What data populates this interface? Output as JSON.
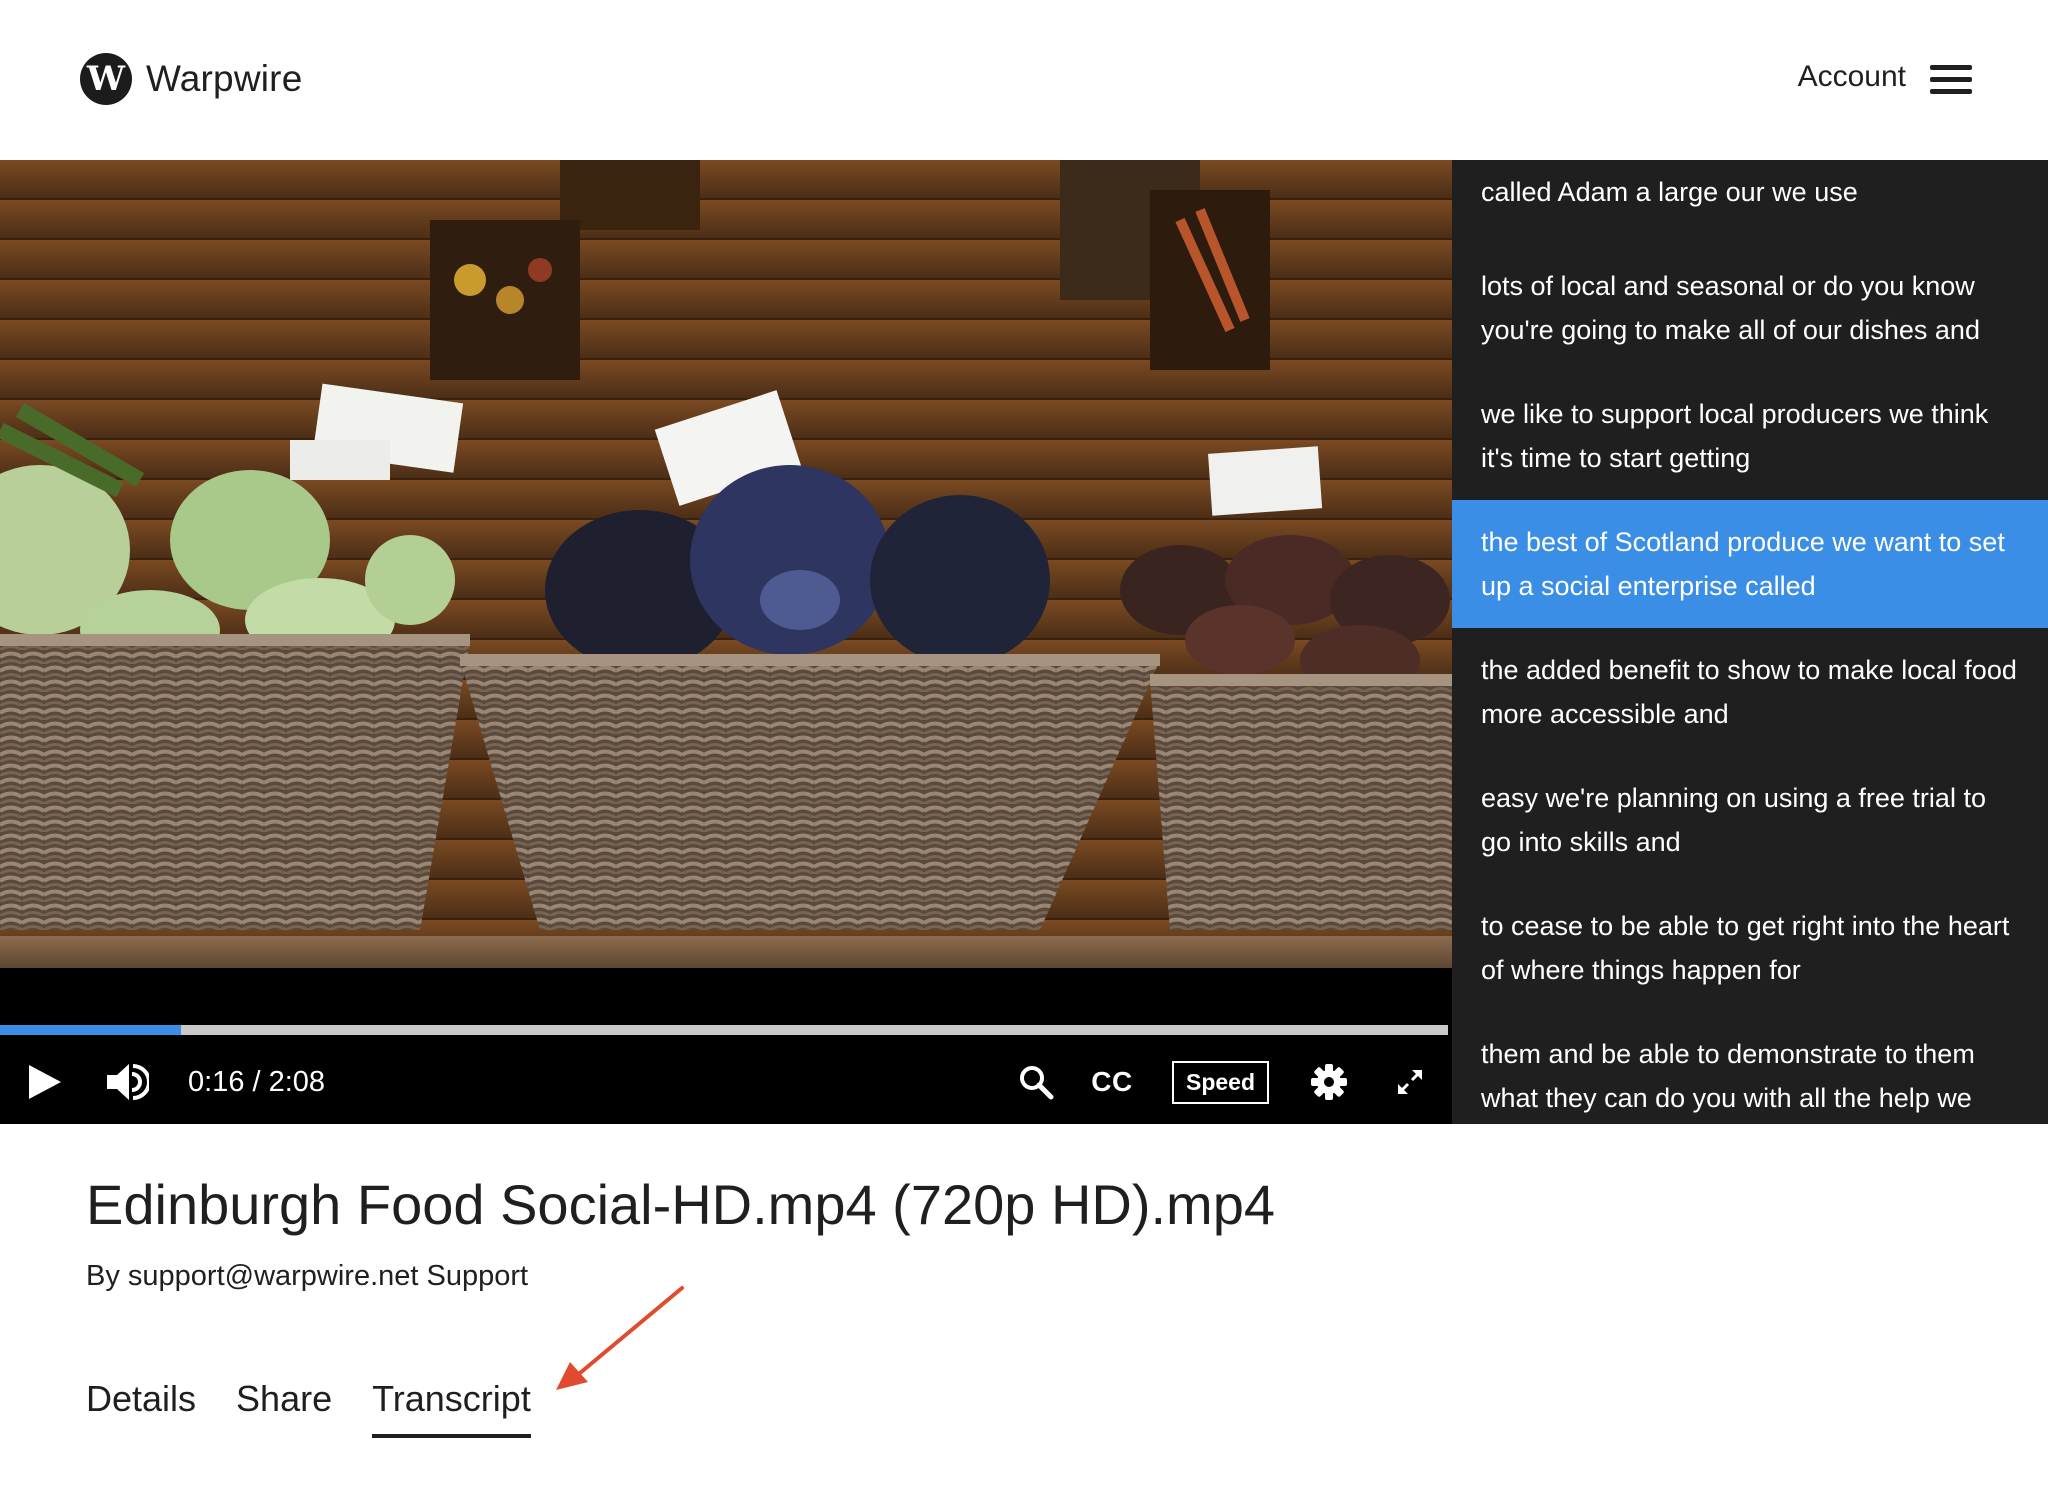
{
  "header": {
    "logo_letter": "W",
    "brand": "Warpwire",
    "account_label": "Account",
    "menu_icon": "hamburger-menu-icon"
  },
  "player": {
    "current_time": "0:16",
    "duration": "2:08",
    "time_display": "0:16 / 2:08",
    "progress_fraction": 0.125,
    "cc_label": "CC",
    "speed_label": "Speed",
    "icons": [
      "play-icon",
      "volume-icon",
      "search-icon",
      "settings-gear-icon",
      "fullscreen-icon"
    ],
    "accent_color": "#3a8ee6"
  },
  "transcript": {
    "segments": [
      {
        "text": "called Adam a large our we use",
        "active": false
      },
      {
        "text": "lots of local and seasonal or do you know you're going to make all of our dishes and",
        "active": false
      },
      {
        "text": "we like to support local producers we think it's time to start getting",
        "active": false
      },
      {
        "text": "the best of Scotland produce we want to set up a social enterprise called",
        "active": true
      },
      {
        "text": "the added benefit to show to make local food more accessible and",
        "active": false
      },
      {
        "text": "easy we're planning on using a free trial to go into skills and",
        "active": false
      },
      {
        "text": "to cease to be able to get right into the heart of where things happen for",
        "active": false
      },
      {
        "text": "them and be able to demonstrate to them what they can do you with all the help we",
        "active": false
      }
    ],
    "active_color": "#3a8ee6"
  },
  "video_info": {
    "title": "Edinburgh Food Social-HD.mp4 (720p HD).mp4",
    "byline": "By support@warpwire.net Support"
  },
  "tabs": [
    {
      "label": "Details",
      "active": false
    },
    {
      "label": "Share",
      "active": false
    },
    {
      "label": "Transcript",
      "active": true
    }
  ],
  "annotation": {
    "arrow_color": "#e04a2f"
  }
}
